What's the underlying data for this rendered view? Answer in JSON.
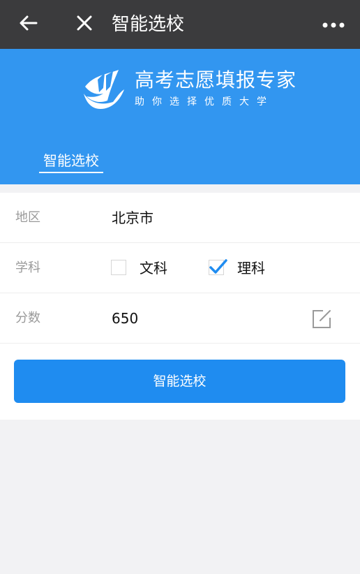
{
  "topbar": {
    "back_icon": "arrow-left-icon",
    "close_icon": "close-icon",
    "title": "智能选校",
    "more_icon": "more-dots-icon"
  },
  "header": {
    "logo_icon": "book-logo-icon",
    "brand_title": "高考志愿填报专家",
    "brand_subtitle": "助你选择优质大学",
    "active_tab": "智能选校",
    "background_color": "#3296f0"
  },
  "form": {
    "region": {
      "label": "地区",
      "value": "北京市"
    },
    "subject": {
      "label": "学科",
      "options": [
        {
          "label": "文科",
          "checked": false
        },
        {
          "label": "理科",
          "checked": true
        }
      ]
    },
    "score": {
      "label": "分数",
      "value": "650",
      "edit_icon": "edit-icon"
    },
    "submit_label": "智能选校",
    "accent_color": "#1f8cf0"
  }
}
